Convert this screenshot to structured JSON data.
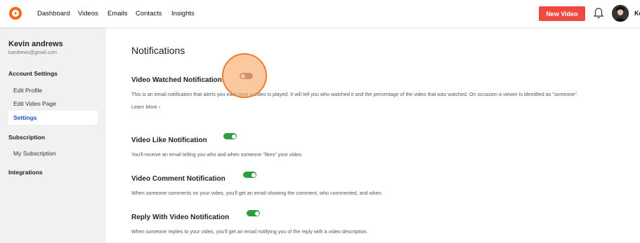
{
  "nav": {
    "items": [
      {
        "label": "Dashboard"
      },
      {
        "label": "Videos"
      },
      {
        "label": "Emails"
      },
      {
        "label": "Contacts"
      },
      {
        "label": "Insights"
      }
    ],
    "new_video_label": "New Video",
    "user_truncated": "Ke"
  },
  "sidebar": {
    "user_name": "Kevin andrews",
    "user_email": "kandrews@gmail.com",
    "account_settings_label": "Account Settings",
    "items": [
      {
        "label": "Edit Profile"
      },
      {
        "label": "Edit Video Page"
      },
      {
        "label": "Settings",
        "active": true
      }
    ],
    "subscription_label": "Subscription",
    "subscription_items": [
      {
        "label": "My Subscription"
      }
    ],
    "integrations_label": "Integrations"
  },
  "main": {
    "title": "Notifications",
    "settings": [
      {
        "title": "Video Watched Notification",
        "enabled": false,
        "description": "This is an email notification that alerts you each time a video is played. It will tell you who watched it and the percentage of the video that was watched. On occasion a viewer is identified as \"someone\".",
        "learn_more": "Learn More ›"
      },
      {
        "title": "Video Like Notification",
        "enabled": true,
        "description": "You'll receive an email telling you who and when someone \"likes\" your video."
      },
      {
        "title": "Video Comment Notification",
        "enabled": true,
        "description": "When someone comments on your video, you'll get an email showing the comment, who commented, and when."
      },
      {
        "title": "Reply With Video Notification",
        "enabled": true,
        "description": "When someone replies to your video, you'll get an email notifying you of the reply with a video description."
      }
    ]
  },
  "colors": {
    "accent_new_video": "#ef4a42",
    "toggle_on": "#2e9c3f",
    "toggle_off": "#8a6b62",
    "active_sidebar_text": "#1d4ed8"
  },
  "icons": [
    "play-logo-icon",
    "bell-icon",
    "user-avatar"
  ]
}
